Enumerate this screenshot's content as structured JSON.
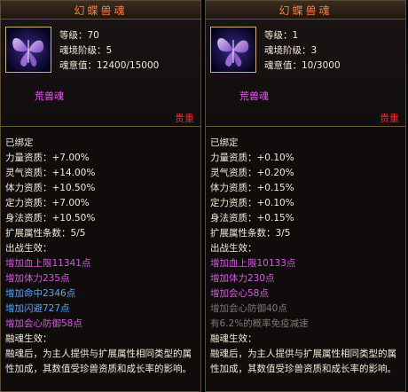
{
  "panels": [
    {
      "title": "幻蝶兽魂",
      "level": "等级：70",
      "realm": "魂境阶级：5",
      "soul_value": "魂意值：12400/15000",
      "soul_name": "荒兽魂",
      "rarity": "贵重",
      "bound": "已绑定",
      "aptitudes": [
        "力量资质：+7.00%",
        "灵气资质：+14.00%",
        "体力资质：+10.50%",
        "定力资质：+7.00%",
        "身法资质：+10.50%"
      ],
      "ext_count": "扩展属性条数：5/5",
      "battle_header": "出战生效：",
      "battle_effects": [
        {
          "text": "增加血上限11341点",
          "color": "purple"
        },
        {
          "text": "增加体力235点",
          "color": "purple"
        },
        {
          "text": "增加命中2346点",
          "color": "blue"
        },
        {
          "text": "增加闪避727点",
          "color": "blue"
        },
        {
          "text": "增加会心防御58点",
          "color": "purple"
        }
      ],
      "fusion_header": "融魂生效：",
      "fusion_desc": "融魂后，为主人提供与扩展属性相同类型的属性加成，其数值受珍兽资质和成长率的影响。"
    },
    {
      "title": "幻蝶兽魂",
      "level": "等级：1",
      "realm": "魂境阶级：3",
      "soul_value": "魂意值：10/3000",
      "soul_name": "荒兽魂",
      "rarity": "贵重",
      "bound": "已绑定",
      "aptitudes": [
        "力量资质：+0.10%",
        "灵气资质：+0.20%",
        "体力资质：+0.15%",
        "定力资质：+0.10%",
        "身法资质：+0.15%"
      ],
      "ext_count": "扩展属性条数：3/5",
      "battle_header": "出战生效：",
      "battle_effects": [
        {
          "text": "增加血上限10133点",
          "color": "purple"
        },
        {
          "text": "增加体力230点",
          "color": "purple"
        },
        {
          "text": "增加会心58点",
          "color": "purple"
        },
        {
          "text": "增加会心防御40点",
          "color": "gray"
        },
        {
          "text": "有6.2%的概率免疫减速",
          "color": "gray"
        }
      ],
      "fusion_header": "融魂生效：",
      "fusion_desc": "融魂后，为主人提供与扩展属性相同类型的属性加成，其数值受珍兽资质和成长率的影响。"
    }
  ]
}
